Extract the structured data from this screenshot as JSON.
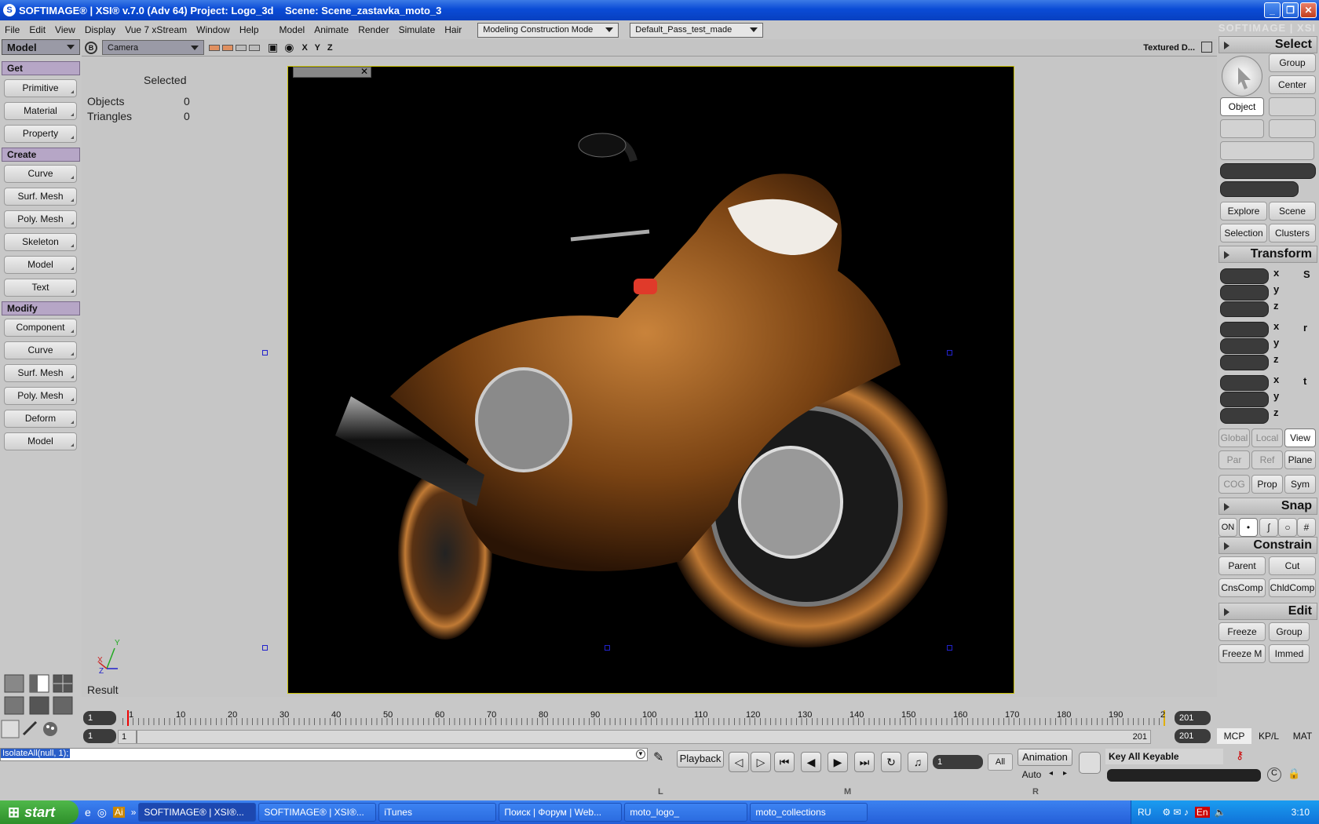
{
  "window": {
    "title": "SOFTIMAGE® | XSI® v.7.0 (Adv 64) Project: Logo_3d    Scene: Scene_zastavka_moto_3",
    "brand": "SOFTIMAGE | XSI",
    "controls": [
      "_",
      "❐",
      "✕"
    ]
  },
  "menubar": {
    "items": [
      "File",
      "Edit",
      "View",
      "Display",
      "Vue 7 xStream",
      "Window",
      "Help"
    ],
    "modules": [
      "Model",
      "Animate",
      "Render",
      "Simulate",
      "Hair"
    ],
    "mode": "Modeling Construction Mode",
    "pass": "Default_Pass_test_made"
  },
  "leftpanel": {
    "selector": "Model",
    "sections": [
      {
        "title": "Get",
        "buttons": [
          "Primitive",
          "Material",
          "Property"
        ]
      },
      {
        "title": "Create",
        "buttons": [
          "Curve",
          "Surf. Mesh",
          "Poly. Mesh",
          "Skeleton",
          "Model",
          "Text"
        ]
      },
      {
        "title": "Modify",
        "buttons": [
          "Component",
          "Curve",
          "Surf. Mesh",
          "Poly. Mesh",
          "Deform",
          "Model"
        ]
      }
    ]
  },
  "viewport": {
    "camera": "Camera",
    "axes": "X Y Z",
    "display_mode": "Textured D...",
    "selected_label": "Selected",
    "objects_label": "Objects",
    "objects_value": "0",
    "triangles_label": "Triangles",
    "triangles_value": "0",
    "result_label": "Result",
    "axis_y": "Y",
    "axis_x": "X",
    "axis_z": "Z"
  },
  "rightpanel": {
    "select": {
      "title": "Select",
      "group": "Group",
      "center": "Center",
      "object": "Object"
    },
    "explore": [
      "Explore",
      "Scene",
      "Selection",
      "Clusters"
    ],
    "transform": {
      "title": "Transform",
      "axes": [
        "x",
        "y",
        "z"
      ],
      "side": [
        "S",
        "r",
        "t"
      ]
    },
    "space_row1": [
      "Global",
      "Local",
      "View"
    ],
    "space_row2": [
      "Par",
      "Ref",
      "Plane"
    ],
    "space_row3": [
      "COG",
      "Prop",
      "Sym"
    ],
    "snap": {
      "title": "Snap",
      "on": "ON"
    },
    "constrain": {
      "title": "Constrain",
      "buttons": [
        "Parent",
        "Cut",
        "CnsComp",
        "ChldComp"
      ]
    },
    "edit": {
      "title": "Edit",
      "buttons": [
        "Freeze",
        "Group",
        "Freeze M",
        "Immed"
      ]
    },
    "tabs": [
      "MCP",
      "KP/L",
      "MAT"
    ]
  },
  "timeline": {
    "start": "1",
    "end": "201",
    "end2": "201",
    "range_start": "1",
    "range_field": "1",
    "range_end": "201",
    "ticks": [
      "1",
      "10",
      "20",
      "30",
      "40",
      "50",
      "60",
      "70",
      "80",
      "90",
      "100",
      "110",
      "120",
      "130",
      "140",
      "150",
      "160",
      "170",
      "180",
      "190",
      "2"
    ]
  },
  "bottombar": {
    "command": "IsolateAll(null, 1);",
    "playback": "Playback",
    "frame": "1",
    "all": "All",
    "animation": "Animation",
    "auto": "Auto",
    "key_label": "Key All Keyable",
    "markers": [
      "L",
      "M",
      "R"
    ]
  },
  "taskbar": {
    "start": "start",
    "tasks": [
      "SOFTIMAGE® | XSI®...",
      "SOFTIMAGE® | XSI®...",
      "iTunes",
      "Поиск | Форум | Web...",
      "moto_logo_",
      "moto_collections"
    ],
    "lang": "RU",
    "lang2": "En",
    "time": "3:10"
  },
  "colors": {
    "title_blue": "#0a4bd6",
    "section_purple": "#b6a6c6",
    "taskbar": "#245ed8",
    "viewport_border": "#c8c000"
  }
}
